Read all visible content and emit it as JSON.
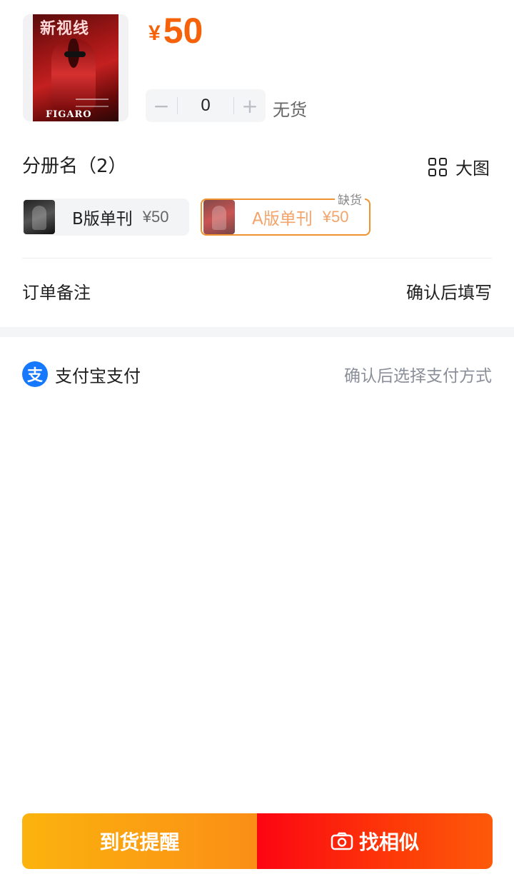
{
  "product": {
    "cover_title": "新视线",
    "cover_brand": "FIGARO",
    "price_currency": "¥",
    "price_value": "50",
    "quantity": "0",
    "minus_label": "−",
    "plus_label": "+",
    "stock_status": "无货"
  },
  "variants": {
    "section_title": "分册名（2）",
    "big_view_label": "大图",
    "items": [
      {
        "name": "B版单刊",
        "price": "¥50",
        "selected": false
      },
      {
        "name": "A版单刊",
        "price": "¥50",
        "selected": true,
        "badge": "缺货"
      }
    ]
  },
  "order_remark": {
    "label": "订单备注",
    "value": "确认后填写"
  },
  "payment": {
    "icon": "alipay-icon",
    "icon_glyph": "支",
    "label": "支付宝支付",
    "value": "确认后选择支付方式"
  },
  "actions": {
    "notify_label": "到货提醒",
    "similar_label": "找相似"
  },
  "colors": {
    "accent": "#f5620a",
    "notify_button": "#fba312",
    "similar_button": "#fc1a10",
    "alipay": "#1677ff"
  }
}
